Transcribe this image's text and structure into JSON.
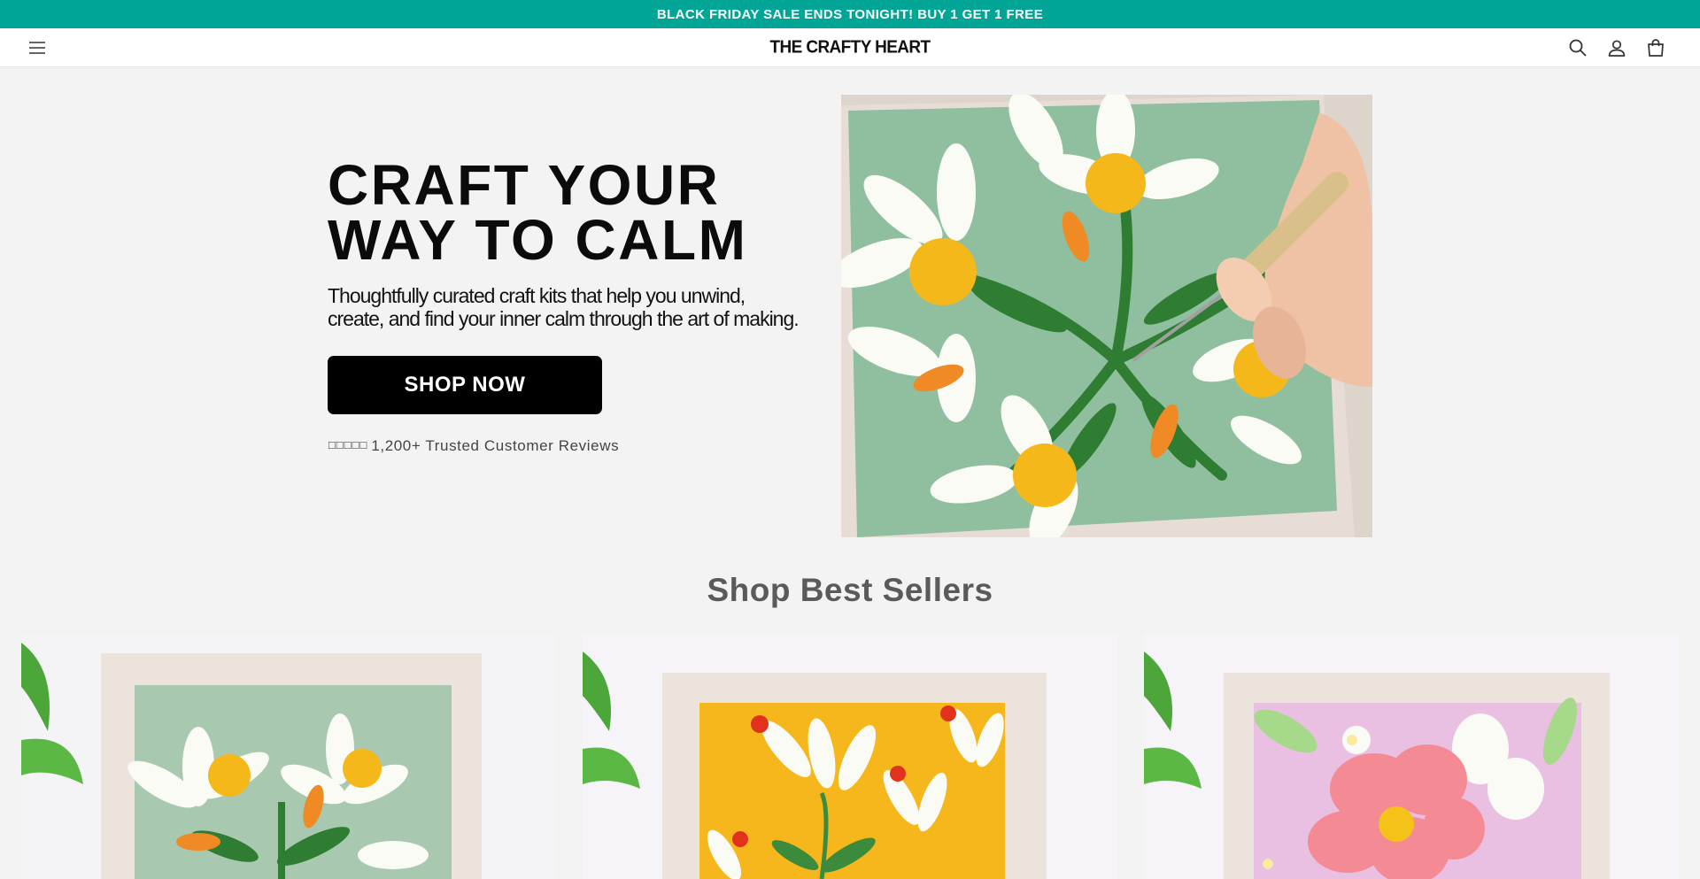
{
  "announcement": {
    "text": "BLACK FRIDAY SALE ENDS TONIGHT! BUY 1 GET 1 FREE"
  },
  "header": {
    "logo": "THE CRAFTY HEART",
    "icons": [
      "menu-icon",
      "search-icon",
      "account-icon",
      "cart-icon"
    ]
  },
  "hero": {
    "title_lines": [
      "CRAFT YOUR",
      "WAY TO CALM"
    ],
    "subtitle_lines": [
      "Thoughtfully curated craft kits that help you unwind,",
      "create, and find your inner calm through the art of making."
    ],
    "button_label": "SHOP NOW",
    "reviews_text": "1,200+ Trusted Customer Reviews"
  },
  "best_sellers": {
    "title": "Shop Best Sellers"
  },
  "colors": {
    "announcement_bg": "#00a596",
    "page_bg": "#f3f3f3",
    "button_bg": "#000000",
    "section_title": "#5a5a5a"
  }
}
